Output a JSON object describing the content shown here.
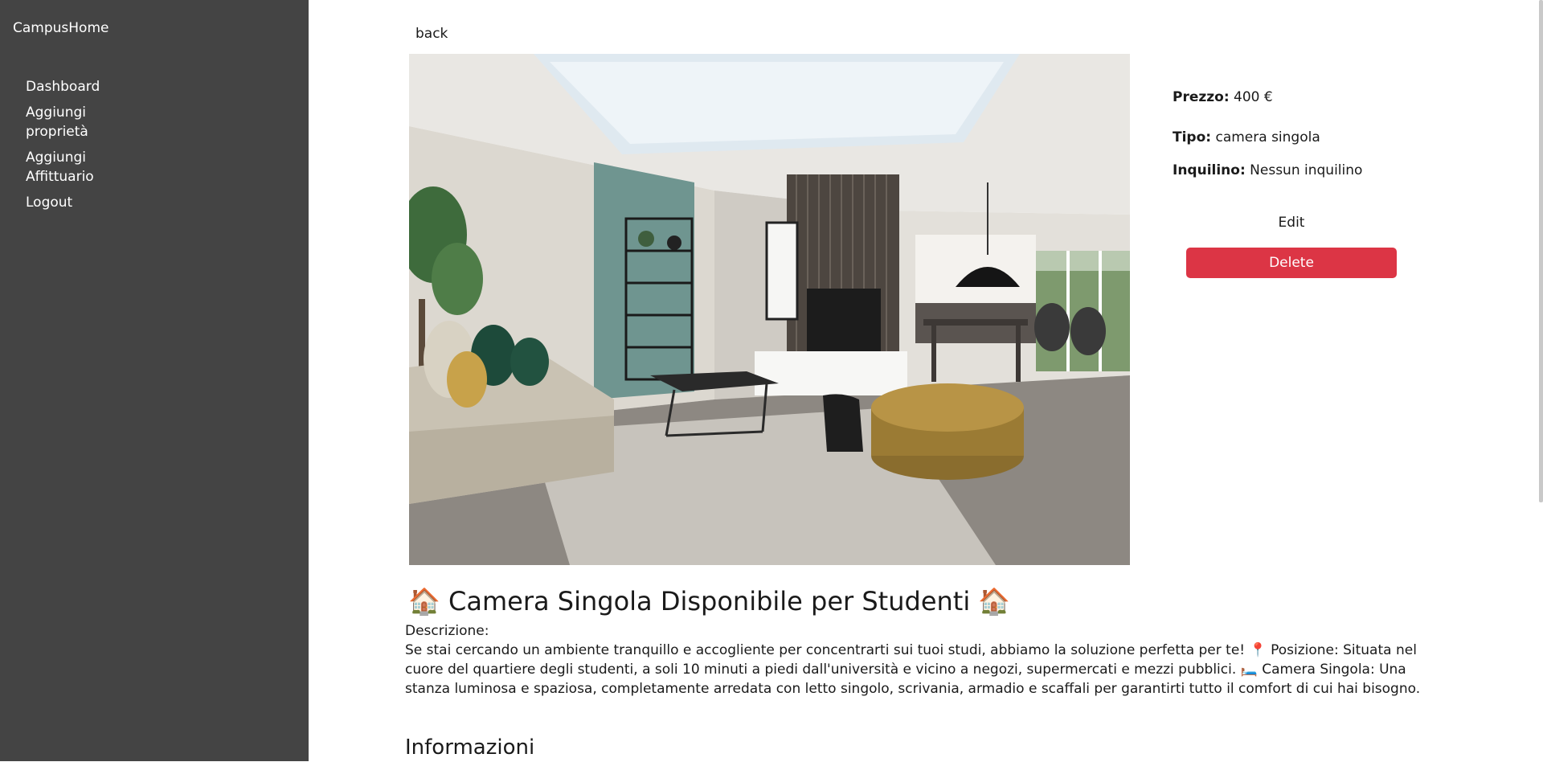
{
  "sidebar": {
    "brand": "CampusHome",
    "nav": [
      {
        "label": "Dashboard"
      },
      {
        "label": "Aggiungi proprietà"
      },
      {
        "label": "Aggiungi Affittuario"
      },
      {
        "label": "Logout"
      }
    ]
  },
  "main": {
    "back_label": "back",
    "details": {
      "price_label": "Prezzo:",
      "price_value": "400 €",
      "type_label": "Tipo:",
      "type_value": "camera singola",
      "tenant_label": "Inquilino:",
      "tenant_value": "Nessun inquilino"
    },
    "edit_label": "Edit",
    "delete_label": "Delete",
    "listing_title": "🏠 Camera Singola Disponibile per Studenti 🏠",
    "description_label": "Descrizione:",
    "description_text": "Se stai cercando un ambiente tranquillo e accogliente per concentrarti sui tuoi studi, abbiamo la soluzione perfetta per te! 📍 Posizione: Situata nel cuore del quartiere degli studenti, a soli 10 minuti a piedi dall'università e vicino a negozi, supermercati e mezzi pubblici. 🛏️ Camera Singola: Una stanza luminosa e spaziosa, completamente arredata con letto singolo, scrivania, armadio e scaffali per garantirti tutto il comfort di cui hai bisogno.",
    "info_heading": "Informazioni"
  },
  "colors": {
    "sidebar_bg": "#444444",
    "danger": "#dc3545"
  }
}
